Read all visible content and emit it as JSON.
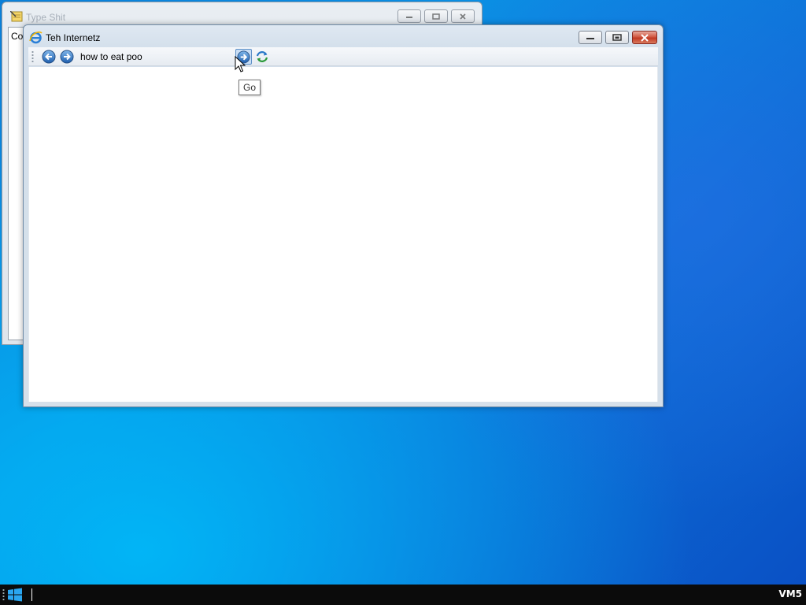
{
  "background_window": {
    "title": "Type Shit",
    "content_text": "Co",
    "icon": "notepad-icon"
  },
  "browser_window": {
    "title": "Teh Internetz",
    "icon": "internet-explorer-icon",
    "toolbar": {
      "address_value": "how to eat poo",
      "back_icon": "back-arrow-icon",
      "forward_icon": "forward-arrow-icon",
      "go_icon": "go-arrow-icon",
      "refresh_icon": "refresh-icon"
    },
    "tooltip": "Go"
  },
  "taskbar": {
    "start_icon": "windows-logo-icon",
    "label": "VM5"
  },
  "colors": {
    "desktop": "#0a8fe3",
    "close_button": "#c23a24",
    "taskbar": "#0b0b0b"
  }
}
